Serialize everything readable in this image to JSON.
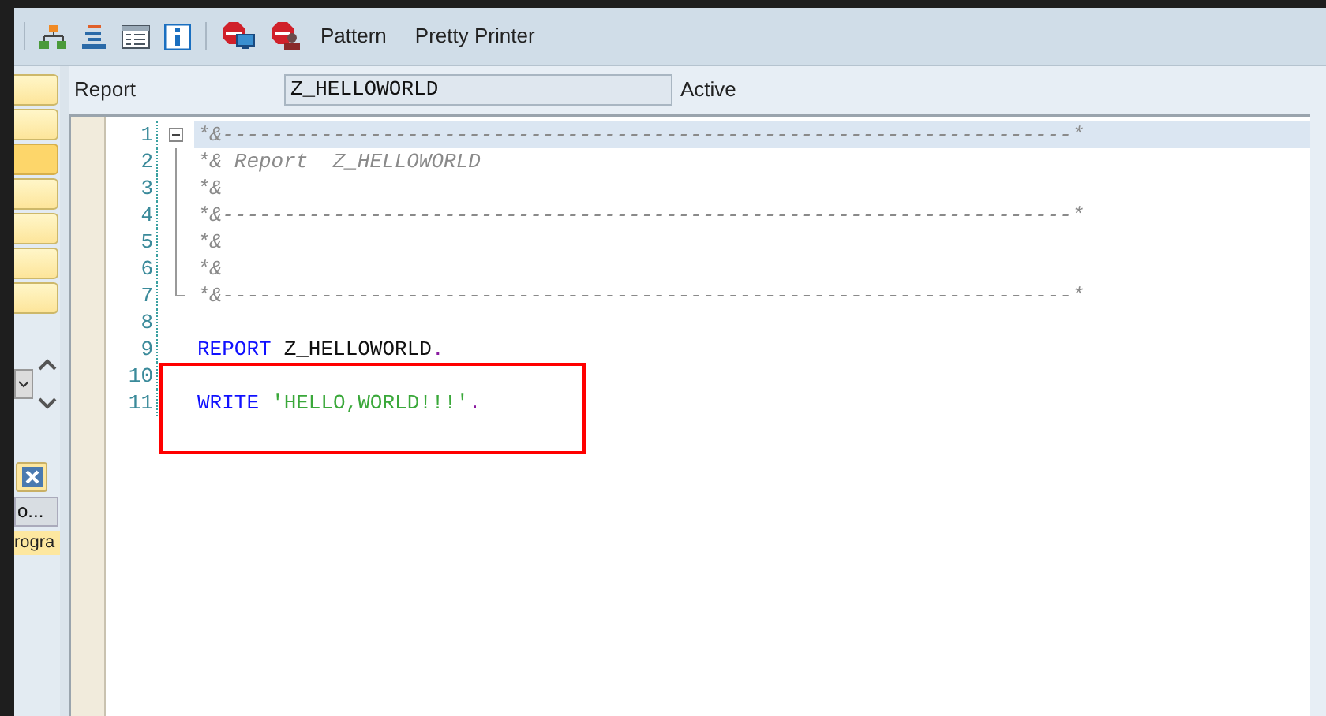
{
  "toolbar": {
    "icons": [
      {
        "kind": "hierarchy"
      },
      {
        "kind": "indent"
      },
      {
        "kind": "form"
      },
      {
        "kind": "info"
      },
      {
        "kind": "stop-screen"
      },
      {
        "kind": "stop-person"
      }
    ],
    "buttons": [
      "Pattern",
      "Pretty Printer"
    ]
  },
  "side_panel": {
    "buttons": [
      {
        "selected": false
      },
      {
        "selected": false
      },
      {
        "selected": true
      },
      {
        "selected": false
      },
      {
        "selected": false
      },
      {
        "selected": false
      },
      {
        "selected": false
      }
    ],
    "truncated_button": "o...",
    "truncated_text": "rogra"
  },
  "header": {
    "label": "Report",
    "value": "Z_HELLOWORLD",
    "status": "Active"
  },
  "editor": {
    "lines": [
      {
        "number": "1",
        "current": true,
        "boxed": false,
        "kind": "fold-start",
        "tokens": [
          {
            "kind": "comment",
            "text": "*&---------------------------------------------------------------------*"
          }
        ]
      },
      {
        "number": "2",
        "current": false,
        "boxed": false,
        "kind": "fold-inner",
        "tokens": [
          {
            "kind": "comment",
            "text": "*& Report  Z_HELLOWORLD"
          }
        ]
      },
      {
        "number": "3",
        "current": false,
        "boxed": false,
        "kind": "fold-inner",
        "tokens": [
          {
            "kind": "comment",
            "text": "*&"
          }
        ]
      },
      {
        "number": "4",
        "current": false,
        "boxed": false,
        "kind": "fold-inner",
        "tokens": [
          {
            "kind": "comment",
            "text": "*&---------------------------------------------------------------------*"
          }
        ]
      },
      {
        "number": "5",
        "current": false,
        "boxed": false,
        "kind": "fold-inner",
        "tokens": [
          {
            "kind": "comment",
            "text": "*&"
          }
        ]
      },
      {
        "number": "6",
        "current": false,
        "boxed": false,
        "kind": "fold-inner",
        "tokens": [
          {
            "kind": "comment",
            "text": "*&"
          }
        ]
      },
      {
        "number": "7",
        "current": false,
        "boxed": false,
        "kind": "fold-end",
        "tokens": [
          {
            "kind": "comment",
            "text": "*&---------------------------------------------------------------------*"
          }
        ]
      },
      {
        "number": "8",
        "current": false,
        "boxed": false,
        "kind": "plain"
      },
      {
        "number": "9",
        "current": false,
        "boxed": false,
        "kind": "plain",
        "tokens": [
          {
            "kind": "keyword",
            "text": "REPORT"
          },
          {
            "kind": "ident",
            "text": "Z_HELLOWORLD"
          },
          {
            "kind": "punct",
            "text": "."
          }
        ]
      },
      {
        "number": "10",
        "current": false,
        "boxed": true,
        "kind": "plain"
      },
      {
        "number": "11",
        "current": false,
        "boxed": true,
        "kind": "plain",
        "tokens": [
          {
            "kind": "keyword",
            "text": "WRITE"
          },
          {
            "kind": "string",
            "text": "'HELLO,WORLD!!!'"
          },
          {
            "kind": "punct",
            "text": "."
          }
        ]
      }
    ]
  }
}
